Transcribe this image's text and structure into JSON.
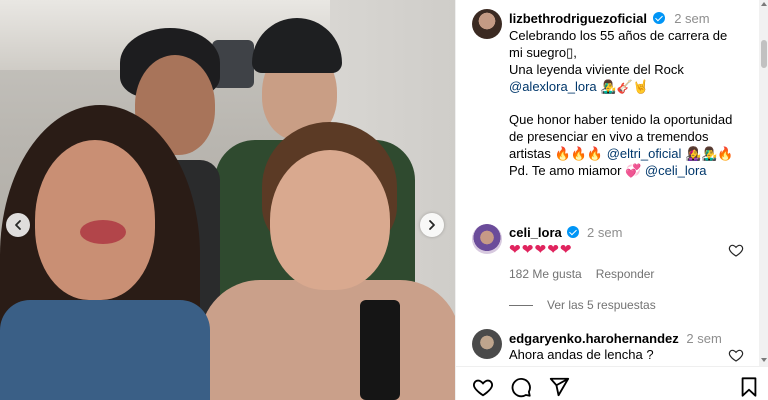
{
  "post": {
    "author": "lizbethrodriguezoficial",
    "time": "2 sem",
    "caption_lines": [
      "Celebrando los 55 años de carrera de",
      "mi suegro▯,",
      "Una leyenda viviente del Rock"
    ],
    "mention_1": "@alexlora_lora",
    "mention_1_emojis": "👨‍🎤🎸🤘",
    "paragraph_2_line_1": "Que honor haber tenido la oportunidad",
    "paragraph_2_line_2": "de presenciar en vivo a tremendos",
    "paragraph_2_line_3_prefix": "artistas",
    "fire_emojis": "🔥🔥🔥",
    "mention_2": "@eltri_oficial",
    "mention_2_emojis": "👩‍🎤👨‍🎤🔥",
    "mention_3": "@celi_lora",
    "last_line_prefix": "Pd. Te amo miamor",
    "heart_emoji": "💞"
  },
  "comments": [
    {
      "username": "celi_lora",
      "time": "2 sem",
      "text": "❤❤❤❤❤",
      "likes": "182 Me gusta",
      "reply_label": "Responder",
      "view_replies": "Ver las 5 respuestas"
    },
    {
      "username": "edgaryenko.harohernandez",
      "time": "2 sem",
      "text": "Ahora andas de lencha ?"
    }
  ],
  "icons": {
    "prev": "chevron-left-icon",
    "next": "chevron-right-icon",
    "like": "heart-icon",
    "comment": "comment-icon",
    "share": "send-icon",
    "save": "bookmark-icon"
  },
  "colors": {
    "verified": "#0095f6",
    "mention": "#00376b",
    "secondary_text": "#8e8e8e",
    "hearts": "#e0245e"
  }
}
